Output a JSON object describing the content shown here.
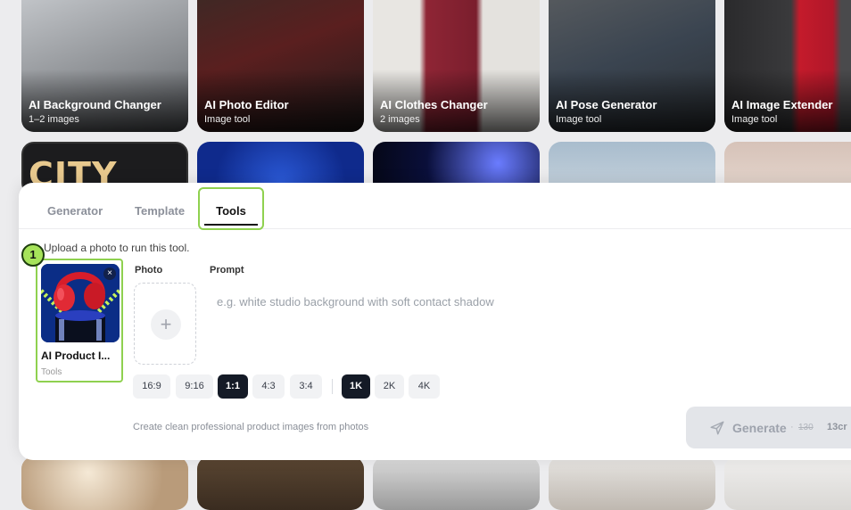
{
  "gallery": {
    "row1": [
      {
        "title": "AI Background Changer",
        "subtitle": "1–2 images"
      },
      {
        "title": "AI Photo Editor",
        "subtitle": "Image tool"
      },
      {
        "title": "AI Clothes Changer",
        "subtitle": "2 images"
      },
      {
        "title": "AI Pose Generator",
        "subtitle": "Image tool"
      },
      {
        "title": "AI Image Extender",
        "subtitle": "Image tool"
      }
    ],
    "row2_poster_text": "CITY NIGHTS"
  },
  "tabs": [
    {
      "label": "Generator"
    },
    {
      "label": "Template"
    },
    {
      "label": "Tools"
    }
  ],
  "active_tab": "Tools",
  "hint": "Upload a photo to run this tool.",
  "step_number": "1",
  "selected_tool": {
    "name": "AI Product I...",
    "category": "Tools",
    "remove_symbol": "×"
  },
  "photo": {
    "label": "Photo",
    "add_symbol": "+"
  },
  "prompt": {
    "label": "Prompt",
    "value": "",
    "placeholder": "e.g. white studio background with soft contact shadow"
  },
  "aspect_ratios": {
    "options": [
      "16:9",
      "9:16",
      "1:1",
      "4:3",
      "3:4"
    ],
    "selected": "1:1"
  },
  "resolutions": {
    "options": [
      "1K",
      "2K",
      "4K"
    ],
    "selected": "1K"
  },
  "footer": "Create clean professional product images from photos",
  "generate": {
    "label": "Generate",
    "separator": "·",
    "old_cost": "130",
    "new_cost": "13cr"
  },
  "colors": {
    "highlight": "#8fd14f",
    "active_chip": "#141a26",
    "badge": "#a6e35a"
  }
}
